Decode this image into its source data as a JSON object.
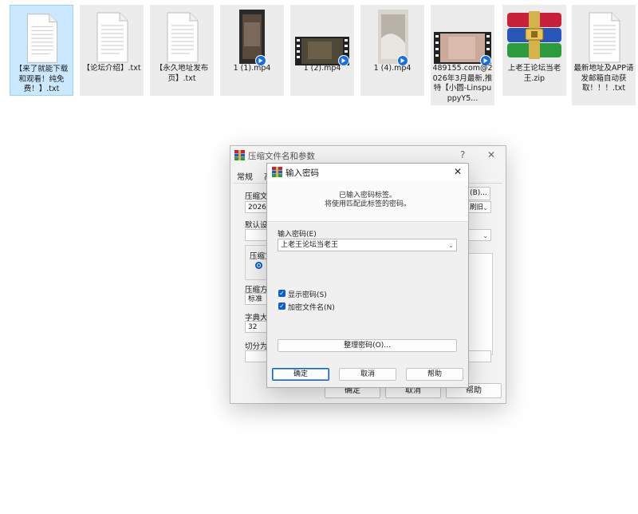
{
  "files": [
    {
      "name": "【来了就能下载和观看！纯免费！】.txt"
    },
    {
      "name": "【论坛介绍】.txt"
    },
    {
      "name": "【永久地址发布页】.txt"
    },
    {
      "name": "1 (1).mp4"
    },
    {
      "name": "1 (2).mp4"
    },
    {
      "name": "1 (4).mp4"
    },
    {
      "name": "489155.com@2026年3月最新,推特【小圆-LinspuppyY5..."
    },
    {
      "name": "上老王论坛当老王.zip"
    },
    {
      "name": "最新地址及APP请发邮箱自动获取！！！.txt"
    }
  ],
  "archive_dialog": {
    "title": "压缩文件名和参数",
    "help_glyph": "?",
    "close_glyph": "✕",
    "tab_general": "常规",
    "tab_advanced_partial": "高",
    "archive_name_label": "压缩文",
    "archive_name_value": "2026年",
    "browse_button": "(B)...",
    "update_mode_partial": "刷旧",
    "default_settings_label": "默认设",
    "format_group_label": "压缩文",
    "method_label": "压缩方",
    "method_value": "标准",
    "dict_label": "字典大小",
    "dict_value": "32",
    "split_label": "切分为分",
    "ok": "确定",
    "cancel": "取消",
    "help": "帮助"
  },
  "password_dialog": {
    "title": "输入密码",
    "close_glyph": "✕",
    "info_line1": "已输入密码标签。",
    "info_line2": "将使用匹配此标签的密码。",
    "password_label": "输入密码(E)",
    "password_value": "上老王论坛当老王",
    "show_password": "显示密码(S)",
    "encrypt_filenames": "加密文件名(N)",
    "organize_button": "整理密码(O)...",
    "ok": "确定",
    "cancel": "取消",
    "help": "帮助"
  }
}
